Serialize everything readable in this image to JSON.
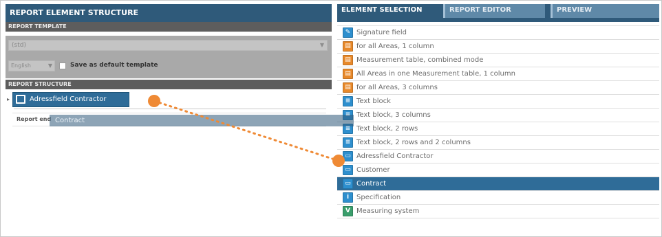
{
  "left_panel": {
    "title": "REPORT ELEMENT STRUCTURE",
    "template_section": "REPORT TEMPLATE",
    "template_select_value": "(std)",
    "language_value": "English",
    "save_default_label": "Save as default template",
    "structure_section": "REPORT STRUCTURE",
    "tree_node_label": "Adressfield Contractor",
    "report_end_label": "Report end"
  },
  "drag_ghost_label": "Contract",
  "right_panel": {
    "tabs": [
      {
        "label": "ELEMENT SELECTION",
        "active": true
      },
      {
        "label": "REPORT EDITOR",
        "active": false
      },
      {
        "label": "PREVIEW",
        "active": false
      }
    ],
    "elements": [
      {
        "label": "Signature field",
        "icon": "signature-icon",
        "color": "#2e8fce",
        "glyph": "✎",
        "selected": false
      },
      {
        "label": "for all Areas, 1 column",
        "icon": "area-table-icon",
        "color": "#e8892a",
        "glyph": "▤",
        "selected": false
      },
      {
        "label": "Measurement table, combined mode",
        "icon": "measurement-table-icon",
        "color": "#e8892a",
        "glyph": "▤",
        "selected": false
      },
      {
        "label": "All Areas in one Measurement table, 1 column",
        "icon": "area-table-icon",
        "color": "#e8892a",
        "glyph": "▤",
        "selected": false
      },
      {
        "label": "for all Areas, 3 columns",
        "icon": "area-table-icon",
        "color": "#e8892a",
        "glyph": "▤",
        "selected": false
      },
      {
        "label": "Text block",
        "icon": "text-block-icon",
        "color": "#2e8fce",
        "glyph": "≡",
        "selected": false
      },
      {
        "label": "Text block, 3 columns",
        "icon": "text-block-icon",
        "color": "#2e8fce",
        "glyph": "≡",
        "selected": false
      },
      {
        "label": "Text block, 2 rows",
        "icon": "text-block-icon",
        "color": "#2e8fce",
        "glyph": "≡",
        "selected": false
      },
      {
        "label": "Text block, 2 rows and 2 columns",
        "icon": "text-block-icon",
        "color": "#2e8fce",
        "glyph": "≡",
        "selected": false
      },
      {
        "label": "Adressfield Contractor",
        "icon": "address-field-icon",
        "color": "#2e8fce",
        "glyph": "▭",
        "selected": false
      },
      {
        "label": "Customer",
        "icon": "address-field-icon",
        "color": "#2e8fce",
        "glyph": "▭",
        "selected": false
      },
      {
        "label": "Contract",
        "icon": "contract-icon",
        "color": "#2e8fce",
        "glyph": "▭",
        "selected": true
      },
      {
        "label": "Specification",
        "icon": "info-icon",
        "color": "#2e8fce",
        "glyph": "i",
        "selected": false
      },
      {
        "label": "Measuring system",
        "icon": "measuring-system-icon",
        "color": "#3a9e6c",
        "glyph": "V",
        "selected": false
      }
    ]
  },
  "colors": {
    "header_blue": "#2f5a7a",
    "selected_blue": "#2f6c98",
    "drag_indicator": "#ef8a35"
  }
}
